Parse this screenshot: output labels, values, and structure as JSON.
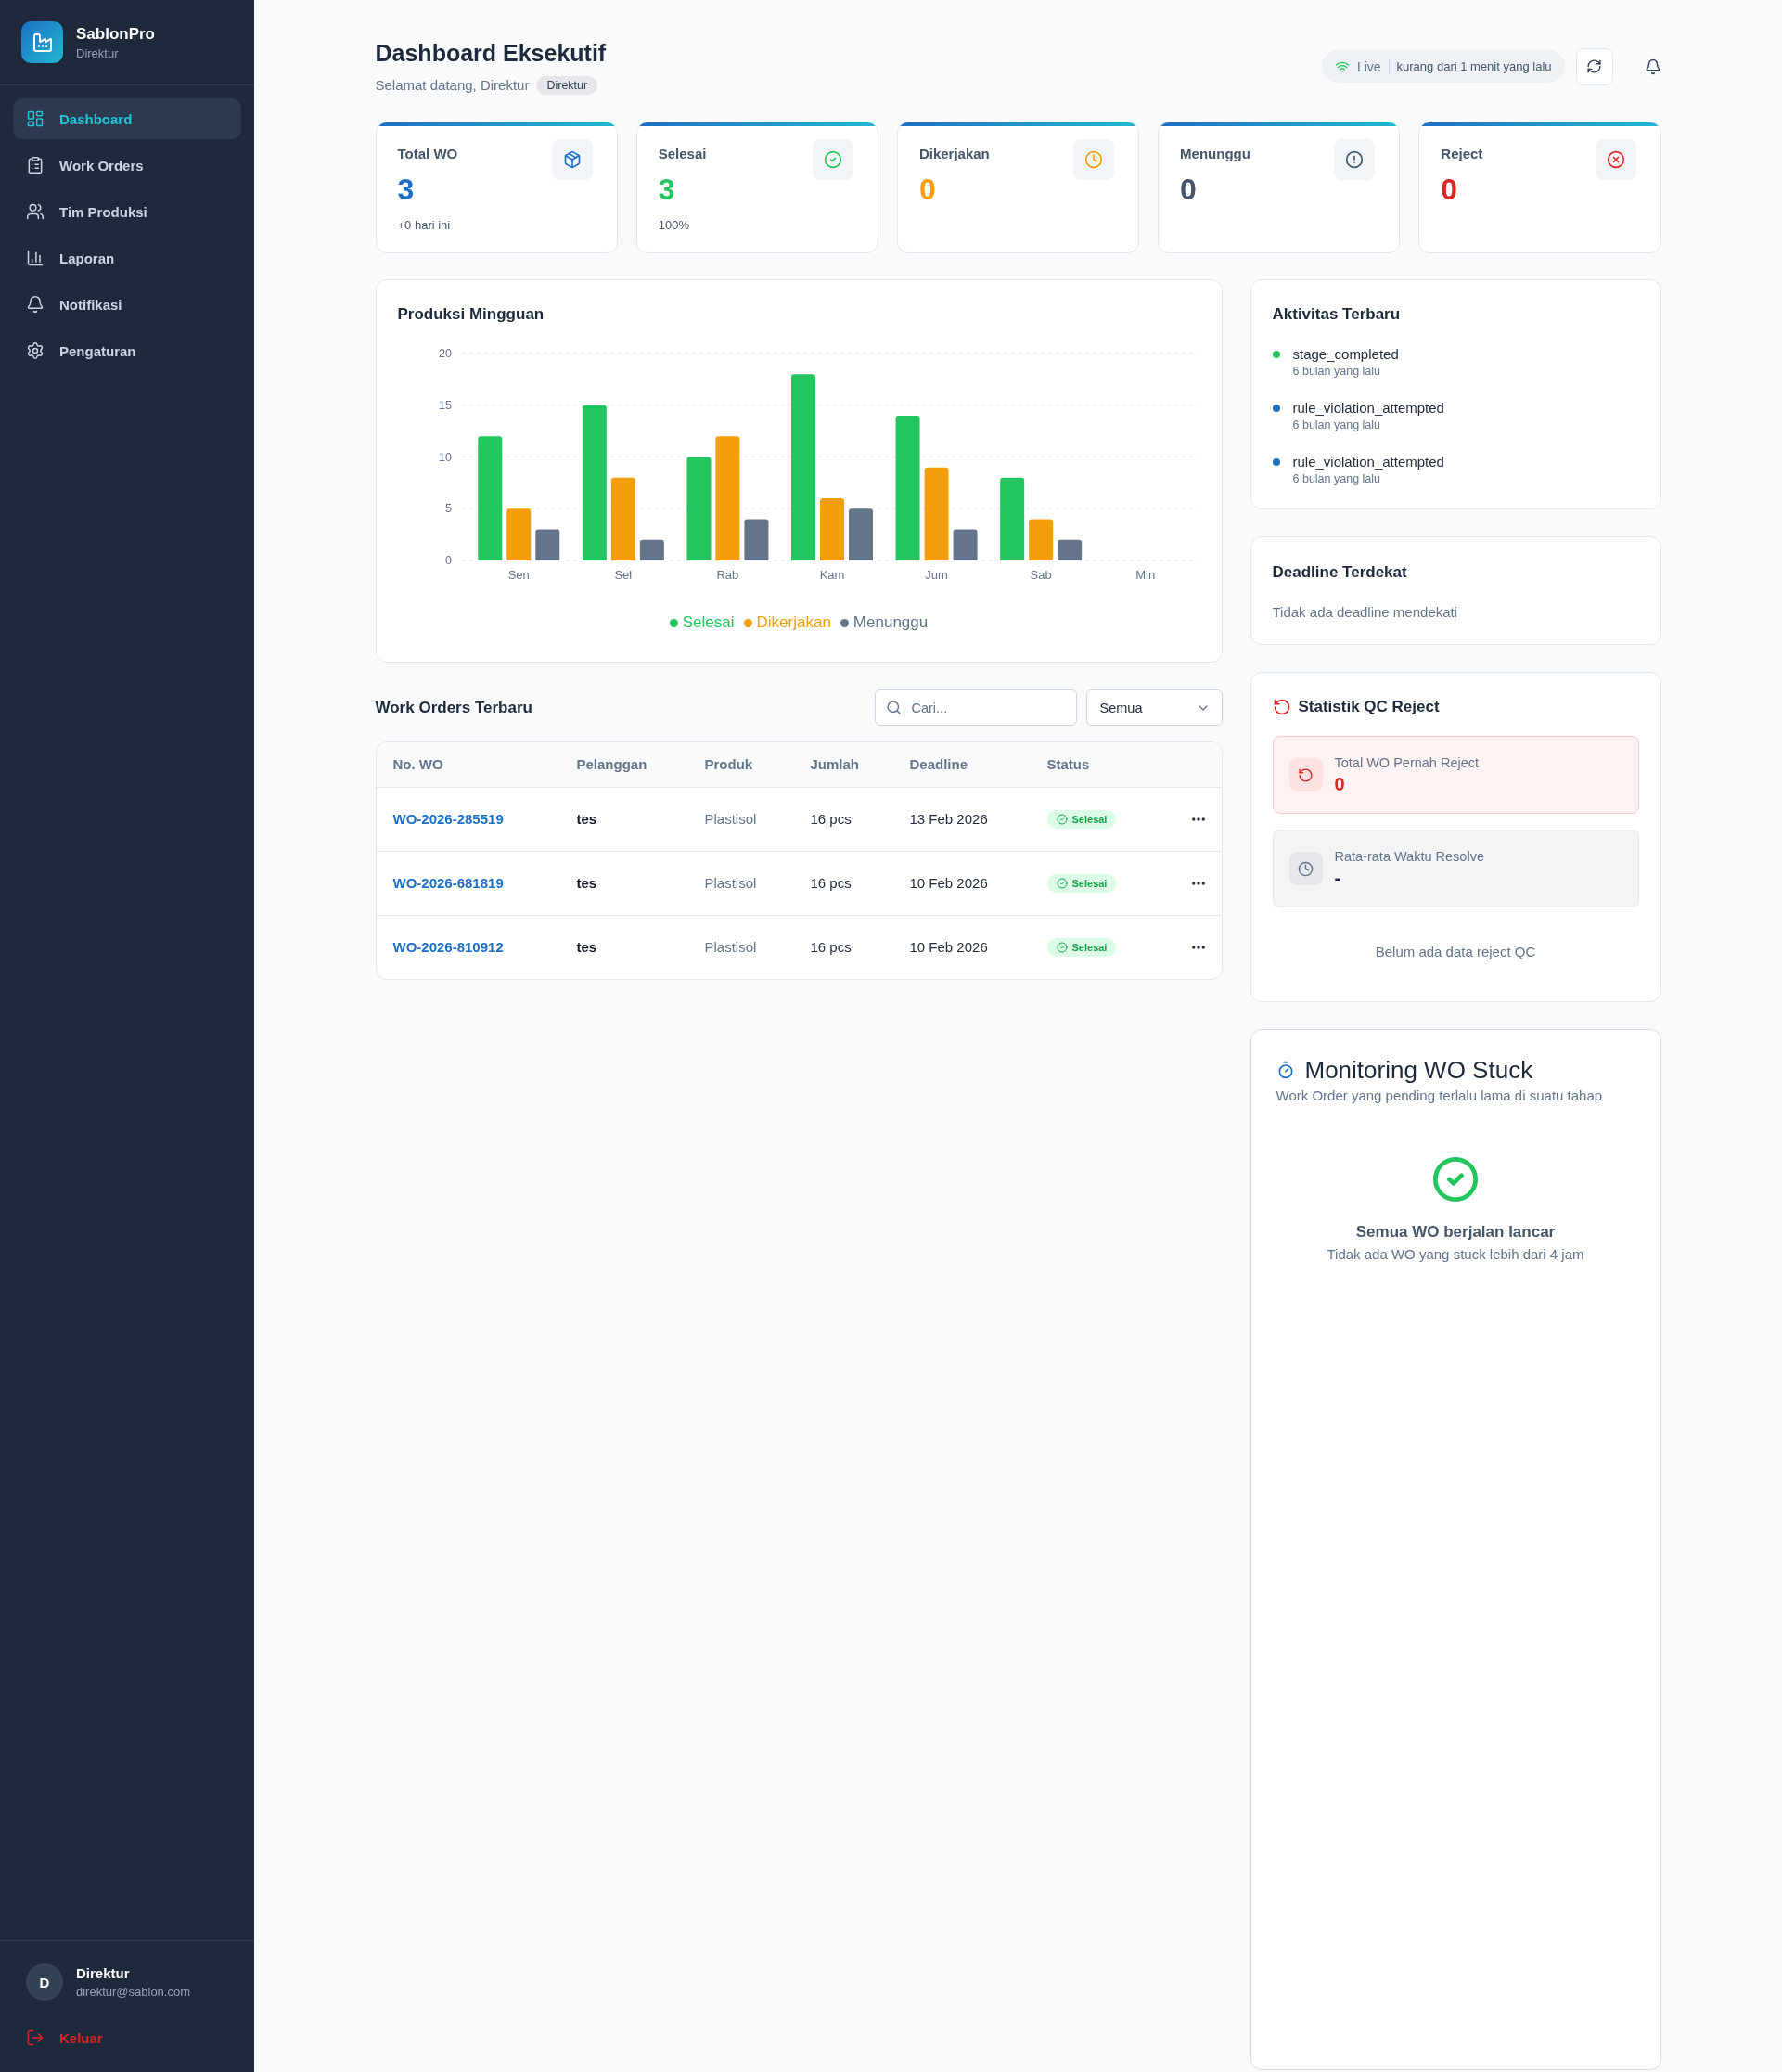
{
  "sidebar": {
    "brand": "SablonPro",
    "role": "Direktur",
    "nav": [
      {
        "label": "Dashboard",
        "selected": true
      },
      {
        "label": "Work Orders",
        "selected": false
      },
      {
        "label": "Tim Produksi",
        "selected": false
      },
      {
        "label": "Laporan",
        "selected": false
      },
      {
        "label": "Notifikasi",
        "selected": false
      },
      {
        "label": "Pengaturan",
        "selected": false
      }
    ],
    "user": {
      "initial": "D",
      "name": "Direktur",
      "email": "direktur@sablon.com"
    },
    "logout": "Keluar"
  },
  "header": {
    "title": "Dashboard Eksekutif",
    "greeting": "Selamat datang, Direktur",
    "role_badge": "Direktur",
    "live": {
      "label": "Live",
      "updated": "kurang dari 1 menit yang lalu"
    }
  },
  "stats": [
    {
      "label": "Total WO",
      "value": "3",
      "note": "+0 hari ini",
      "color": "#1e6fc8"
    },
    {
      "label": "Selesai",
      "value": "3",
      "note": "100%",
      "color": "#22c55e"
    },
    {
      "label": "Dikerjakan",
      "value": "0",
      "color": "#f59e0b"
    },
    {
      "label": "Menunggu",
      "value": "0",
      "color": "#475569"
    },
    {
      "label": "Reject",
      "value": "0",
      "color": "#dc2626"
    }
  ],
  "weekly_production": {
    "title": "Produksi Mingguan",
    "chart_data": {
      "type": "bar",
      "categories": [
        "Sen",
        "Sel",
        "Rab",
        "Kam",
        "Jum",
        "Sab",
        "Min"
      ],
      "series": [
        {
          "name": "Selesai",
          "color": "#22c55e",
          "values": [
            12,
            15,
            10,
            18,
            14,
            8,
            0
          ]
        },
        {
          "name": "Dikerjakan",
          "color": "#f59e0b",
          "values": [
            5,
            8,
            12,
            6,
            9,
            4,
            0
          ]
        },
        {
          "name": "Menunggu",
          "color": "#64748b",
          "values": [
            3,
            2,
            4,
            5,
            3,
            2,
            0
          ]
        }
      ],
      "ylim": [
        0,
        20
      ],
      "yticks": [
        0,
        5,
        10,
        15,
        20
      ],
      "grid": true,
      "legend": true
    }
  },
  "work_orders": {
    "title": "Work Orders Terbaru",
    "search": {
      "placeholder": "Cari..."
    },
    "filter": {
      "value": "Semua"
    },
    "columns": [
      "No. WO",
      "Pelanggan",
      "Produk",
      "Jumlah",
      "Deadline",
      "Status"
    ],
    "rows": [
      {
        "number": "WO-2026-285519",
        "customer": "tes",
        "product": "Plastisol",
        "quantity": "16 pcs",
        "deadline": "13 Feb 2026",
        "status": "Selesai"
      },
      {
        "number": "WO-2026-681819",
        "customer": "tes",
        "product": "Plastisol",
        "quantity": "16 pcs",
        "deadline": "10 Feb 2026",
        "status": "Selesai"
      },
      {
        "number": "WO-2026-810912",
        "customer": "tes",
        "product": "Plastisol",
        "quantity": "16 pcs",
        "deadline": "10 Feb 2026",
        "status": "Selesai"
      }
    ]
  },
  "recent_activity": {
    "title": "Aktivitas Terbaru",
    "items": [
      {
        "event": "stage_completed",
        "time": "6 bulan yang lalu",
        "color": "#22c55e"
      },
      {
        "event": "rule_violation_attempted",
        "time": "6 bulan yang lalu",
        "color": "#1d6fc4"
      },
      {
        "event": "rule_violation_attempted",
        "time": "6 bulan yang lalu",
        "color": "#1d6fc4"
      }
    ]
  },
  "upcoming_deadlines": {
    "title": "Deadline Terdekat",
    "empty_text": "Tidak ada deadline mendekati"
  },
  "qc_reject": {
    "title": "Statistik QC Reject",
    "metrics": [
      {
        "kind": "danger",
        "label": "Total WO Pernah Reject",
        "value": "0"
      },
      {
        "kind": "neutral",
        "label": "Rata-rata Waktu Resolve",
        "value": "-"
      }
    ],
    "empty_text": "Belum ada data reject QC"
  },
  "stuck_monitoring": {
    "title": "Monitoring WO Stuck",
    "subtitle": "Work Order yang pending terlalu lama di suatu tahap",
    "status_title": "Semua WO berjalan lancar",
    "status_text": "Tidak ada WO yang stuck lebih dari 4 jam"
  }
}
